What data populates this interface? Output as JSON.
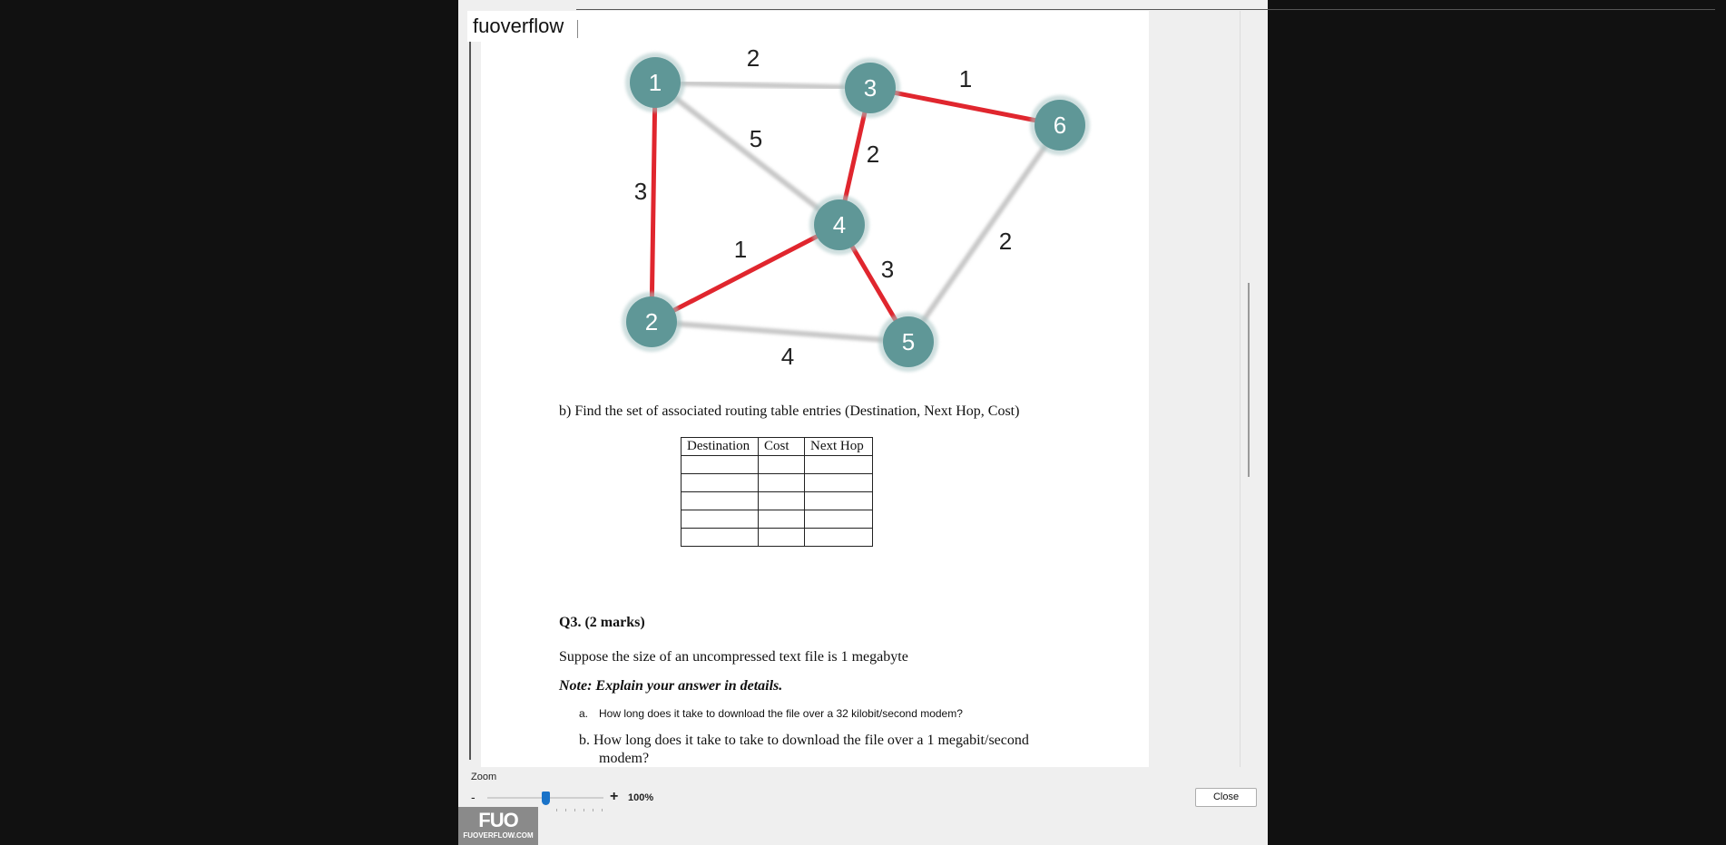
{
  "app": {
    "title": "fuoverflow"
  },
  "graph": {
    "nodes": [
      "1",
      "2",
      "3",
      "4",
      "5",
      "6"
    ],
    "edges": [
      {
        "from": "1",
        "to": "3",
        "cost": "2",
        "highlighted": false
      },
      {
        "from": "1",
        "to": "4",
        "cost": "5",
        "highlighted": false
      },
      {
        "from": "1",
        "to": "2",
        "cost": "3",
        "highlighted": true
      },
      {
        "from": "3",
        "to": "6",
        "cost": "1",
        "highlighted": true
      },
      {
        "from": "3",
        "to": "4",
        "cost": "2",
        "highlighted": true
      },
      {
        "from": "2",
        "to": "4",
        "cost": "1",
        "highlighted": true
      },
      {
        "from": "4",
        "to": "5",
        "cost": "3",
        "highlighted": true
      },
      {
        "from": "6",
        "to": "5",
        "cost": "2",
        "highlighted": false
      },
      {
        "from": "2",
        "to": "5",
        "cost": "4",
        "highlighted": false
      }
    ],
    "colors": {
      "node": "#5f9797",
      "edge_highlight": "#e0262e",
      "edge_normal": "#c8c8c8"
    }
  },
  "document": {
    "question_b": "b) Find the set of associated routing table entries (Destination, Next Hop, Cost)",
    "table_headers": [
      "Destination",
      "Cost",
      "Next Hop"
    ],
    "table_rows": 5,
    "q3_heading": "Q3. (2 marks)",
    "q3_intro": "Suppose the size of an uncompressed text file is 1 megabyte",
    "q3_note": "Note: Explain your answer in details.",
    "q3_a_marker": "a.",
    "q3_a": "How long does it take to download the file over a 32 kilobit/second modem?",
    "q3_b_line1": "b. How long does it take to take to download the file over a 1 megabit/second",
    "q3_b_line2": "modem?"
  },
  "controls": {
    "zoom_label": "Zoom",
    "zoom_minus": "-",
    "zoom_plus": "+",
    "zoom_value": "100%",
    "zoom_level": 0.5,
    "close_label": "Close"
  },
  "logo": {
    "mark": "FUO",
    "site": "FUOVERFLOW.COM"
  }
}
